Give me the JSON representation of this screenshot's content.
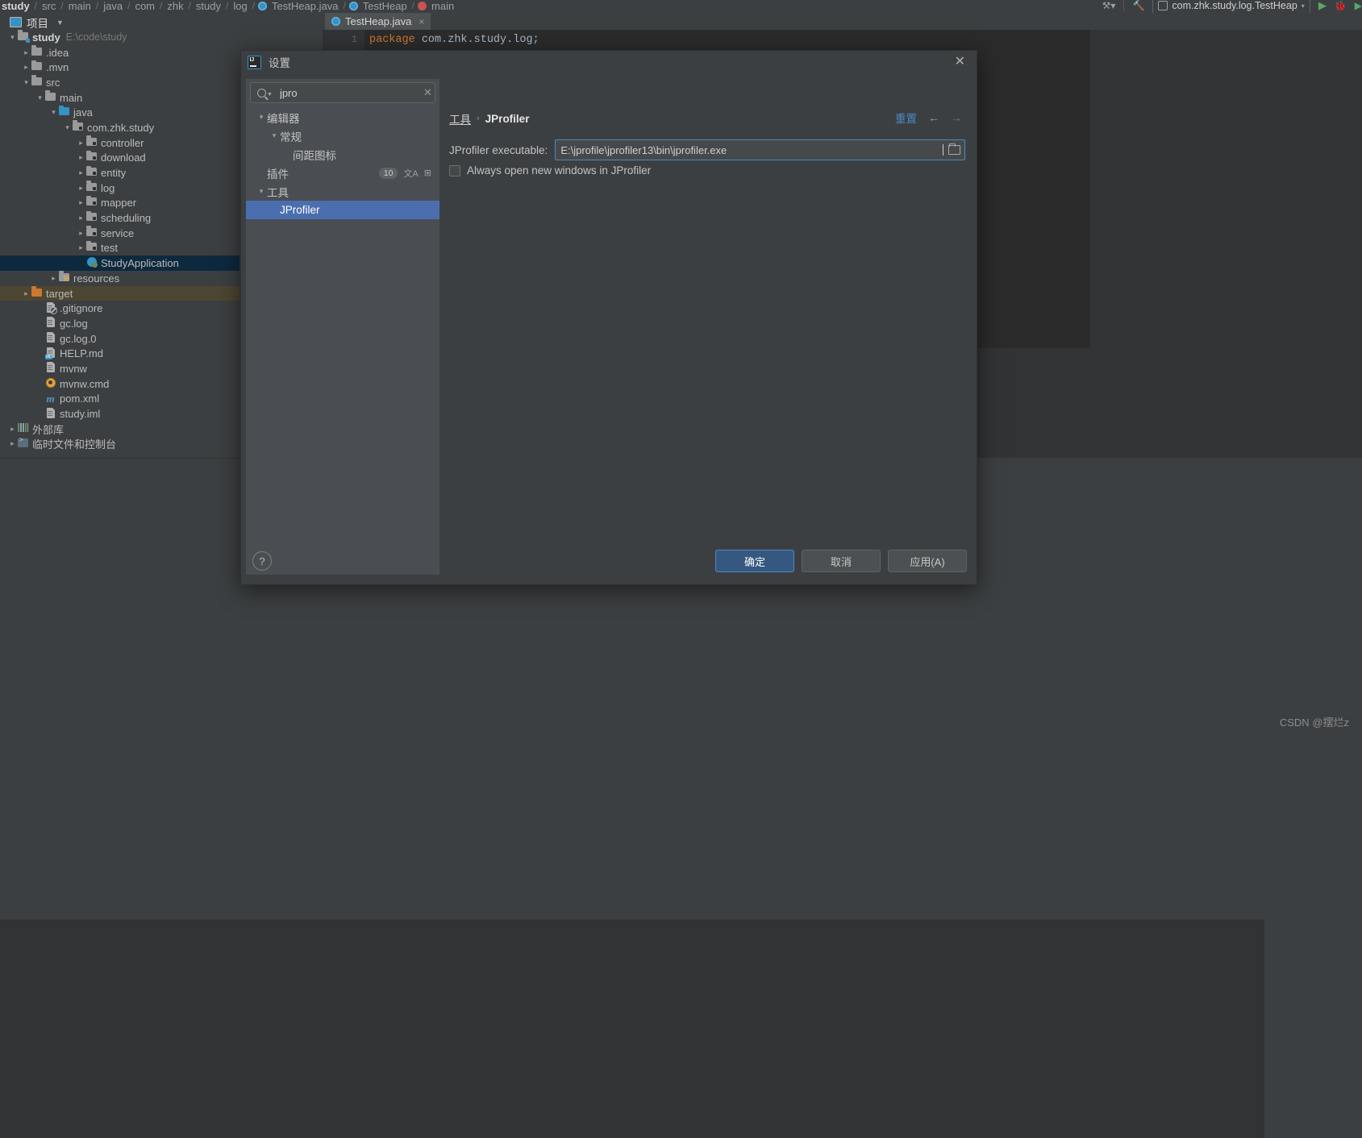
{
  "editor_breadcrumb": [
    {
      "label": "study",
      "bold": true,
      "icon": null
    },
    {
      "label": "src",
      "bold": false,
      "icon": null
    },
    {
      "label": "main",
      "bold": false,
      "icon": null
    },
    {
      "label": "java",
      "bold": false,
      "icon": null
    },
    {
      "label": "com",
      "bold": false,
      "icon": null
    },
    {
      "label": "zhk",
      "bold": false,
      "icon": null
    },
    {
      "label": "study",
      "bold": false,
      "icon": null
    },
    {
      "label": "log",
      "bold": false,
      "icon": null
    },
    {
      "label": "TestHeap.java",
      "bold": false,
      "icon": "class-icon"
    },
    {
      "label": "TestHeap",
      "bold": false,
      "icon": "class-icon"
    },
    {
      "label": "main",
      "bold": false,
      "icon": "method-icon"
    }
  ],
  "toolbar_right": {
    "run_config": "com.zhk.study.log.TestHeap",
    "run_icon": "run-icon",
    "debug_icon": "debug-icon",
    "coverage_icon": "coverage-icon",
    "build_icon": "build-icon",
    "hammer_icon": "hammer-icon"
  },
  "project_panel": {
    "title": "项目",
    "caret": "▾",
    "icons": [
      "locate-icon",
      "expand-all-icon",
      "collapse-all-icon",
      "settings-icon",
      "hide-icon"
    ],
    "tree": [
      {
        "label": "study",
        "secondary": "E:\\code\\study",
        "depth": 0,
        "arrow": "v",
        "icon": "module-folder-icon",
        "bold": true,
        "state": "normal"
      },
      {
        "label": ".idea",
        "secondary": "",
        "depth": 1,
        "arrow": ">",
        "icon": "folder-icon",
        "bold": false,
        "state": "normal"
      },
      {
        "label": ".mvn",
        "secondary": "",
        "depth": 1,
        "arrow": ">",
        "icon": "folder-icon",
        "bold": false,
        "state": "normal"
      },
      {
        "label": "src",
        "secondary": "",
        "depth": 1,
        "arrow": "v",
        "icon": "folder-icon",
        "bold": false,
        "state": "normal"
      },
      {
        "label": "main",
        "secondary": "",
        "depth": 2,
        "arrow": "v",
        "icon": "folder-icon",
        "bold": false,
        "state": "normal"
      },
      {
        "label": "java",
        "secondary": "",
        "depth": 3,
        "arrow": "v",
        "icon": "source-folder-icon",
        "bold": false,
        "state": "normal"
      },
      {
        "label": "com.zhk.study",
        "secondary": "",
        "depth": 4,
        "arrow": "v",
        "icon": "package-icon",
        "bold": false,
        "state": "normal"
      },
      {
        "label": "controller",
        "secondary": "",
        "depth": 5,
        "arrow": ">",
        "icon": "package-icon",
        "bold": false,
        "state": "normal"
      },
      {
        "label": "download",
        "secondary": "",
        "depth": 5,
        "arrow": ">",
        "icon": "package-icon",
        "bold": false,
        "state": "normal"
      },
      {
        "label": "entity",
        "secondary": "",
        "depth": 5,
        "arrow": ">",
        "icon": "package-icon",
        "bold": false,
        "state": "normal"
      },
      {
        "label": "log",
        "secondary": "",
        "depth": 5,
        "arrow": ">",
        "icon": "package-icon",
        "bold": false,
        "state": "normal"
      },
      {
        "label": "mapper",
        "secondary": "",
        "depth": 5,
        "arrow": ">",
        "icon": "package-icon",
        "bold": false,
        "state": "normal"
      },
      {
        "label": "scheduling",
        "secondary": "",
        "depth": 5,
        "arrow": ">",
        "icon": "package-icon",
        "bold": false,
        "state": "normal"
      },
      {
        "label": "service",
        "secondary": "",
        "depth": 5,
        "arrow": ">",
        "icon": "package-icon",
        "bold": false,
        "state": "normal"
      },
      {
        "label": "test",
        "secondary": "",
        "depth": 5,
        "arrow": ">",
        "icon": "package-icon",
        "bold": false,
        "state": "normal"
      },
      {
        "label": "StudyApplication",
        "secondary": "",
        "depth": 5,
        "arrow": "",
        "icon": "spring-class-icon",
        "bold": false,
        "state": "selected"
      },
      {
        "label": "resources",
        "secondary": "",
        "depth": 3,
        "arrow": ">",
        "icon": "resources-folder-icon",
        "bold": false,
        "state": "normal"
      },
      {
        "label": "target",
        "secondary": "",
        "depth": 1,
        "arrow": ">",
        "icon": "excluded-folder-icon",
        "bold": false,
        "state": "target"
      },
      {
        "label": ".gitignore",
        "secondary": "",
        "depth": 2,
        "arrow": "",
        "icon": "gitignore-file-icon",
        "bold": false,
        "state": "normal"
      },
      {
        "label": "gc.log",
        "secondary": "",
        "depth": 2,
        "arrow": "",
        "icon": "text-file-icon",
        "bold": false,
        "state": "normal"
      },
      {
        "label": "gc.log.0",
        "secondary": "",
        "depth": 2,
        "arrow": "",
        "icon": "text-file-icon",
        "bold": false,
        "state": "normal"
      },
      {
        "label": "HELP.md",
        "secondary": "",
        "depth": 2,
        "arrow": "",
        "icon": "markdown-file-icon",
        "bold": false,
        "state": "normal"
      },
      {
        "label": "mvnw",
        "secondary": "",
        "depth": 2,
        "arrow": "",
        "icon": "text-file-icon",
        "bold": false,
        "state": "normal"
      },
      {
        "label": "mvnw.cmd",
        "secondary": "",
        "depth": 2,
        "arrow": "",
        "icon": "cmd-file-icon",
        "bold": false,
        "state": "normal"
      },
      {
        "label": "pom.xml",
        "secondary": "",
        "depth": 2,
        "arrow": "",
        "icon": "maven-file-icon",
        "bold": false,
        "state": "normal"
      },
      {
        "label": "study.iml",
        "secondary": "",
        "depth": 2,
        "arrow": "",
        "icon": "iml-file-icon",
        "bold": false,
        "state": "normal"
      },
      {
        "label": "外部库",
        "secondary": "",
        "depth": 0,
        "arrow": ">",
        "icon": "libraries-icon",
        "bold": false,
        "state": "normal"
      },
      {
        "label": "临时文件和控制台",
        "secondary": "",
        "depth": 0,
        "arrow": ">",
        "icon": "scratches-icon",
        "bold": false,
        "state": "normal"
      }
    ]
  },
  "editor": {
    "tab_label": "TestHeap.java",
    "tab_icon": "java-class-icon",
    "tab_close": "×",
    "line_number": "1",
    "code_keyword": "package",
    "code_rest": " com.zhk.study.log;"
  },
  "settings_dialog": {
    "title": "设置",
    "logo": "intellij-idea-logo",
    "close": "✕",
    "search": {
      "value": "jpro",
      "placeholder": "",
      "clear": "✕",
      "icon": "search-icon"
    },
    "tree": [
      {
        "label": "编辑器",
        "depth": 0,
        "arrow": "v",
        "selected": false,
        "badge": null,
        "icons": []
      },
      {
        "label": "常规",
        "depth": 1,
        "arrow": "v",
        "selected": false,
        "badge": null,
        "icons": []
      },
      {
        "label": "间距图标",
        "depth": 2,
        "arrow": "",
        "selected": false,
        "badge": null,
        "icons": []
      },
      {
        "label": "插件",
        "depth": 0,
        "arrow": "",
        "selected": false,
        "badge": "10",
        "icons": [
          "translate-icon",
          "grid-icon"
        ]
      },
      {
        "label": "工具",
        "depth": 0,
        "arrow": "v",
        "selected": false,
        "badge": null,
        "icons": []
      },
      {
        "label": "JProfiler",
        "depth": 1,
        "arrow": "",
        "selected": true,
        "badge": null,
        "icons": []
      }
    ],
    "breadcrumb": {
      "parent": "工具",
      "separator": "›",
      "current": "JProfiler"
    },
    "reset_label": "重置",
    "nav_back": "←",
    "nav_forward": "→",
    "executable": {
      "label": "JProfiler executable:",
      "value": "E:\\jprofile\\jprofiler13\\bin\\jprofiler.exe",
      "browse_icon": "folder-browse-icon"
    },
    "checkbox": {
      "label": "Always open new windows in JProfiler",
      "checked": false
    },
    "help_label": "?",
    "buttons": {
      "ok": "确定",
      "cancel": "取消",
      "apply": "应用(A)"
    },
    "accent_color": "#4a88c7",
    "selection_color": "#4b6eaf"
  },
  "watermark": "CSDN @摆烂z"
}
